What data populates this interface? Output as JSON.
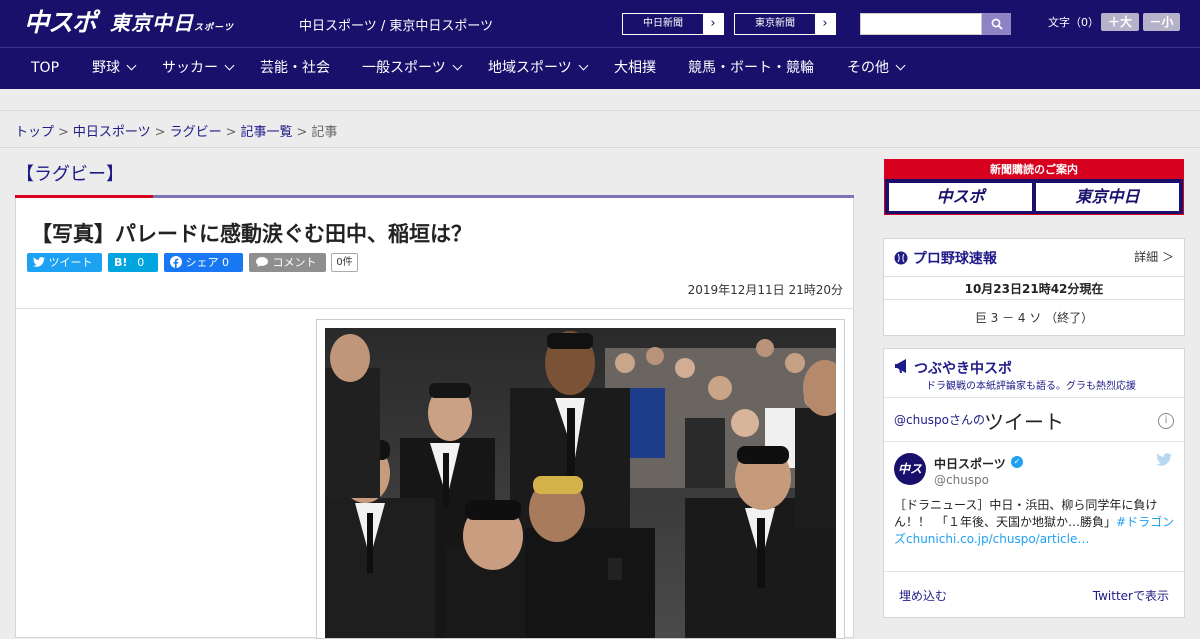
{
  "header": {
    "logo_main": "中スポ",
    "logo_tokyo": "東京中日",
    "logo_tokyo_small": "スポーツ",
    "tagline": "中日スポーツ / 東京中日スポーツ",
    "paper_links": [
      "中日新聞",
      "東京新聞"
    ],
    "search_placeholder": "",
    "font_size_label": "文字（0）",
    "font_plus": "＋大",
    "font_minus": "－小"
  },
  "nav": {
    "items": [
      {
        "label": "TOP",
        "dropdown": false
      },
      {
        "label": "野球",
        "dropdown": true
      },
      {
        "label": "サッカー",
        "dropdown": true
      },
      {
        "label": "芸能・社会",
        "dropdown": false
      },
      {
        "label": "一般スポーツ",
        "dropdown": true
      },
      {
        "label": "地域スポーツ",
        "dropdown": true
      },
      {
        "label": "大相撲",
        "dropdown": false
      },
      {
        "label": "競馬・ボート・競輪",
        "dropdown": false
      },
      {
        "label": "その他",
        "dropdown": true
      }
    ]
  },
  "breadcrumb": [
    "トップ",
    "中日スポーツ",
    "ラグビー",
    "記事一覧",
    "記事"
  ],
  "article": {
    "category": "【ラグビー】",
    "headline": "【写真】パレードに感動涙ぐむ田中、稲垣は？",
    "share": {
      "tweet": "ツイート",
      "hatena": "B!",
      "hatena_count": "0",
      "facebook": "シェア",
      "facebook_count": "0",
      "comment": "コメント",
      "comment_count": "0件"
    },
    "date": "2019年12月11日 21時20分"
  },
  "sidebar": {
    "subscribe_caption": "新聞購読のご案内",
    "subscribe_left": "中スポ",
    "subscribe_right": "東京中日",
    "baseball": {
      "title": "プロ野球速報",
      "more": "詳細 ＞",
      "as_of": "10月23日21時42分現在",
      "game": "巨 3 － 4 ソ （終了）"
    },
    "tweets": {
      "title": "つぶやき中スポ",
      "subtitle": "ドラ観戦の本紙評論家も語る。グラも熱烈応援",
      "by_prefix": "@chuspoさんの",
      "by_title": "ツイート",
      "account_name": "中日スポーツ",
      "handle": "@chuspo",
      "text": "［ドラニュース］中日・浜田、柳ら同学年に負けん！！　「１年後、天国か地獄か…勝負」",
      "text_link": "#ドラゴンズchunichi.co.jp/chuspo/article…",
      "embed": "埋め込む",
      "view_on": "Twitterで表示"
    }
  },
  "colors": {
    "brand_navy": "#19106c",
    "accent_red": "#d7001f",
    "link_blue": "#1e1a87",
    "twitter_blue": "#1da1f2"
  }
}
